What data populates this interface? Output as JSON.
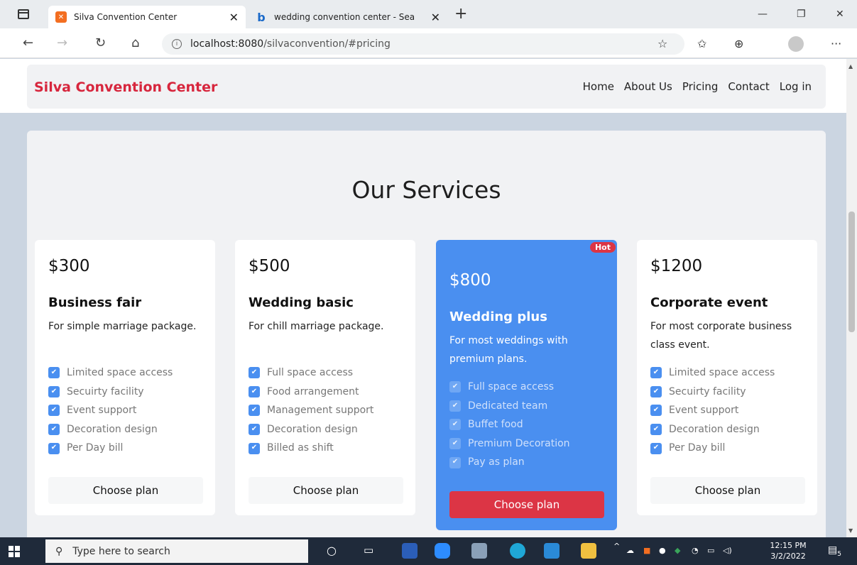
{
  "browser": {
    "tabs": [
      {
        "title": "Silva Convention Center",
        "close": "✕"
      },
      {
        "title": "wedding convention center - Sea",
        "close": "✕"
      }
    ],
    "new_tab": "+",
    "url_host": "localhost:8080",
    "url_path": "/silvaconvention/#pricing",
    "more": "···"
  },
  "site": {
    "brand": "Silva Convention Center",
    "nav": [
      "Home",
      "About Us",
      "Pricing",
      "Contact",
      "Log in"
    ]
  },
  "services": {
    "title": "Our Services",
    "cards": [
      {
        "price": "$300",
        "name": "Business fair",
        "desc": "For simple marriage package.",
        "features": [
          "Limited space access",
          "Secuirty facility",
          "Event support",
          "Decoration design",
          "Per Day bill"
        ],
        "button": "Choose plan"
      },
      {
        "price": "$500",
        "name": "Wedding basic",
        "desc": "For chill marriage package.",
        "features": [
          "Full space access",
          "Food arrangement",
          "Management support",
          "Decoration design",
          "Billed as shift"
        ],
        "button": "Choose plan"
      },
      {
        "price": "$800",
        "name": "Wedding plus",
        "desc": "For most weddings with premium plans.",
        "badge": "Hot",
        "features": [
          "Full space access",
          "Dedicated team",
          "Buffet food",
          "Premium Decoration",
          "Pay as plan"
        ],
        "button": "Choose plan"
      },
      {
        "price": "$1200",
        "name": "Corporate event",
        "desc": "For most corporate business class event.",
        "features": [
          "Limited space access",
          "Secuirty facility",
          "Event support",
          "Decoration design",
          "Per Day bill"
        ],
        "button": "Choose plan"
      }
    ]
  },
  "taskbar": {
    "search_placeholder": "Type here to search",
    "time": "12:15 PM",
    "date": "3/2/2022",
    "notifications": "5"
  },
  "colors": {
    "brand": "#d7263d",
    "featured": "#4a8ff0",
    "cta": "#dc3545"
  }
}
